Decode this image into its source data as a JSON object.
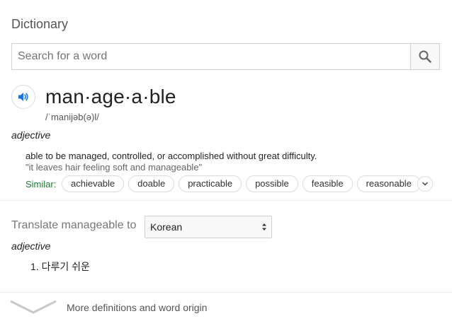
{
  "card": {
    "title": "Dictionary"
  },
  "search": {
    "placeholder": "Search for a word",
    "value": "",
    "button_icon": "search-icon"
  },
  "entry": {
    "speaker_icon": "speaker-icon",
    "headword": "man·age·a·ble",
    "pronunciation": "/ˈmanijəb(ə)l/",
    "part_of_speech": "adjective",
    "definition": "able to be managed, controlled, or accomplished without great difficulty.",
    "example": "\"it leaves hair feeling soft and manageable\"",
    "similar_label": "Similar:",
    "similar": [
      "achievable",
      "doable",
      "practicable",
      "possible",
      "feasible",
      "reasonable"
    ],
    "expand_icon": "chevron-down-icon"
  },
  "translate": {
    "label": "Translate manageable to",
    "selected_language": "Korean",
    "part_of_speech": "adjective",
    "items": [
      "1. 다루기 쉬운"
    ]
  },
  "footer": {
    "icon": "chevron-down-icon",
    "more_label": "More definitions and word origin"
  },
  "colors": {
    "accent_blue": "#1a73e8",
    "similar_green": "#1e7b34",
    "border": "#dadce0"
  }
}
